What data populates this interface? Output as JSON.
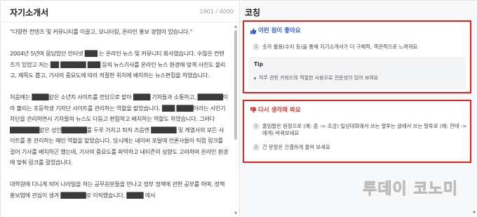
{
  "left": {
    "title": "자기소개서",
    "char_count": "1901 / 4000",
    "paragraphs": [
      "\"다양한 컨텐츠 및 커뮤니티를 이끌고, 모니터링, 온라인 홍보 경험이 있습니다.\"",
      "2004년 5년여 몸담았던 인터넷 ███ 는 온라인 뉴스 및 커뮤니티 회사였습니다. 수많은 컨텐츠가 있었고 저는 ██ ██████ ███ 등의 뉴스기사를 온라인 뉴스 환경에 맞게 사진도 올리고, 제목도 뽑고, 기사의 중요도에 따라 적절한 위치에 배치하는 뉴스편집을 하였습니다.",
      "처음에는 ████같은 소년지 사이트를 전담으로 맡아 ████ 기자들과 소통하고, ██████이라 불리는 초등학생 기자단 사이트를 관리하는 역할을 맡았습니다. ███ ████이라는 시민기자단을 관리하면서 기자들의 뉴스도 다듬고 편집하고 배치하는 역할도 하였습니다. 그러다 ███████같은 성인██████를 두루 거치고 퇴직 즈음엔 ██████ 및 게열사의 모든 사이트를 총 관리하는 메인 역할을 맡았습니다. 당시에는 네이버 포탈에 언론사들이 직접 링크를 걸어 기사를 배치하곤 했는데, 기사의 중요도를 파악하고 네티즌의 성향도 고려하여 온라인 환경에 맞춰 링크를 걸었습니다.",
      "대학원에 다니게 되어 나라일을 하는 공무원분들을 만나고 정부 정책에 관한 공부를 하며, 정책홍보업에 관심이 생겨 ██████로 이직했습니다. ████ 에서"
    ]
  },
  "right": {
    "title": "코칭",
    "good": {
      "heading": "이런 점이 좋아요",
      "items": [
        {
          "num": "1",
          "text": "숫자 활용(수치 등)을 통해 자기소개서가 더 구체적, 객관적으로 느껴져요"
        }
      ],
      "tip_label": "Tip",
      "tip_text": "직무 관련 키워드의 적절한 사용으로 전문성이 있어 보여요"
    },
    "bad": {
      "heading": "다시 생각해 봐요",
      "items": [
        {
          "num": "1",
          "text_line1": "줄임말은 원형으로 (예: 좀 -> 조금) 일상대화에서 쓰는 말투는 글에서 쓰는 말투로 (예: 한테 ->",
          "text_line2": "에게) 바꿔보세요"
        },
        {
          "num": "2",
          "text_line1": "긴 문장은 간결하게 줄여 보세요"
        }
      ]
    }
  },
  "watermark": "투데이 코노미",
  "colors": {
    "highlight_border": "#e32020",
    "good_accent": "#2f5bd1",
    "bad_accent": "#d43a3a"
  },
  "icons": [
    "thumbs-up-icon",
    "thumbs-down-icon",
    "scroll-up-arrow-icon",
    "scroll-down-arrow-icon"
  ]
}
